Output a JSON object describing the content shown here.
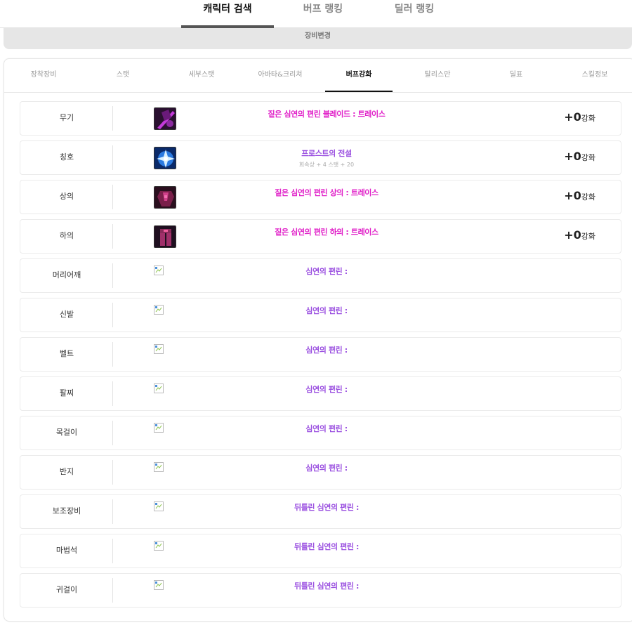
{
  "top_nav": {
    "tabs": [
      "캐릭터 검색",
      "버프 랭킹",
      "딜러 랭킹"
    ],
    "active": 0
  },
  "change_equipment_label": "장비변경",
  "sub_tabs": [
    "장착장비",
    "스탯",
    "세부스탯",
    "아바타&크리쳐",
    "버프강화",
    "탈리스만",
    "딜표",
    "스킬정보"
  ],
  "active_sub_tab": 4,
  "colors": {
    "name_pink": "#e020c8",
    "name_purple": "#9a4fe0",
    "active_border": "#111111"
  },
  "equipment": [
    {
      "slot": "무기",
      "name": "짙은 심연의 편린 블레이드 : 트레이스",
      "color": "#e020c8",
      "icon": "weapon-icon",
      "enhance": "+0",
      "enhance_unit": "강화"
    },
    {
      "slot": "칭호",
      "name": "프로스트의 전설",
      "sub": "회속상 + 4 스탯 + 20",
      "color": "#9a4fe0",
      "icon": "title-icon",
      "enhance": "+0",
      "enhance_unit": "강화"
    },
    {
      "slot": "상의",
      "name": "짙은 심연의 편린 상의 : 트레이스",
      "color": "#e020c8",
      "icon": "top-armor-icon",
      "enhance": "+0",
      "enhance_unit": "강화"
    },
    {
      "slot": "하의",
      "name": "짙은 심연의 편린 하의 : 트레이스",
      "color": "#e020c8",
      "icon": "bottom-armor-icon",
      "enhance": "+0",
      "enhance_unit": "강화"
    },
    {
      "slot": "머리어깨",
      "name": "심연의 편린 :",
      "color": "#9a4fe0"
    },
    {
      "slot": "신발",
      "name": "심연의 편린 :",
      "color": "#9a4fe0"
    },
    {
      "slot": "벨트",
      "name": "심연의 편린 :",
      "color": "#9a4fe0"
    },
    {
      "slot": "팔찌",
      "name": "심연의 편린 :",
      "color": "#9a4fe0"
    },
    {
      "slot": "목걸이",
      "name": "심연의 편린 :",
      "color": "#9a4fe0"
    },
    {
      "slot": "반지",
      "name": "심연의 편린 :",
      "color": "#9a4fe0"
    },
    {
      "slot": "보조장비",
      "name": "뒤틀린 심연의 편린 :",
      "color": "#9a4fe0"
    },
    {
      "slot": "마법석",
      "name": "뒤틀린 심연의 편린 :",
      "color": "#9a4fe0"
    },
    {
      "slot": "귀걸이",
      "name": "뒤틀린 심연의 편린 :",
      "color": "#9a4fe0"
    }
  ]
}
